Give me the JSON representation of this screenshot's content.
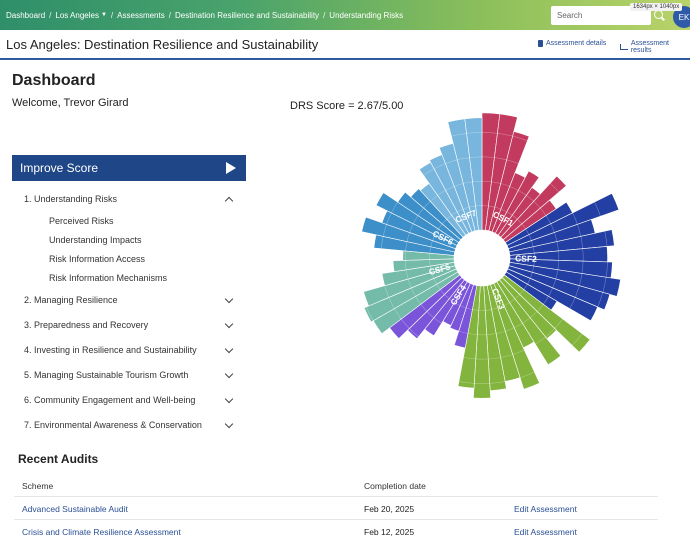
{
  "breadcrumb": [
    "Dashboard",
    "Los Angeles",
    "Assessments",
    "Destination Resilience and Sustainability",
    "Understanding Risks"
  ],
  "search": {
    "placeholder": "Search"
  },
  "size_tip": "1634px × 1040px",
  "avatar_initials": "EK",
  "header": {
    "title": "Los Angeles: Destination Resilience and Sustainability",
    "assessment_details": "Assessment details",
    "assessment_results": "Assessment results"
  },
  "dashboard": {
    "title": "Dashboard",
    "welcome": "Welcome, Trevor Girard"
  },
  "improve": {
    "label": "Improve Score"
  },
  "menu": [
    {
      "label": "1. Understanding Risks",
      "expanded": true,
      "subitems": [
        "Perceived Risks",
        "Understanding Impacts",
        "Risk Information Access",
        "Risk Information Mechanisms"
      ]
    },
    {
      "label": "2. Managing Resilience"
    },
    {
      "label": "3. Preparedness and Recovery"
    },
    {
      "label": "4. Investing in Resilience and Sustainability"
    },
    {
      "label": "5. Managing Sustainable Tourism Growth"
    },
    {
      "label": "6. Community Engagement and Well-being"
    },
    {
      "label": "7. Environmental Awareness & Conservation"
    }
  ],
  "score": {
    "label": "DRS Score = 2.67/5.00"
  },
  "chart_data": {
    "type": "radial-bar",
    "title": "DRS Score = 2.67/5.00",
    "max": 5,
    "sectors": [
      {
        "name": "CSF1",
        "color": "#c23b5e",
        "values": [
          4.8,
          4.8,
          4.2,
          2.6,
          2.9,
          2.4,
          3.4,
          2.5
        ]
      },
      {
        "name": "CSF2",
        "color": "#243fa3",
        "values": [
          3.0,
          4.8,
          3.6,
          4.3,
          4.0,
          4.2,
          4.6,
          4.3,
          4.0,
          2.4
        ]
      },
      {
        "name": "CSF3",
        "color": "#83b43d",
        "values": [
          4.4,
          3.1,
          4.0,
          2.9,
          4.5,
          4.0,
          4.3,
          4.6,
          4.2
        ]
      },
      {
        "name": "CSF4",
        "color": "#7b55d9",
        "values": [
          2.6,
          2.0,
          1.9,
          2.6,
          3.1,
          3.6
        ]
      },
      {
        "name": "CSF5",
        "color": "#74bba9",
        "values": [
          4.0,
          4.1,
          3.9,
          3.0,
          2.5,
          2.1
        ]
      },
      {
        "name": "CSF6",
        "color": "#3d8fc9",
        "values": [
          3.3,
          3.9,
          3.2,
          3.7,
          3.0,
          2.7
        ]
      },
      {
        "name": "CSF7",
        "color": "#78b6de",
        "values": [
          2.6,
          3.3,
          3.4,
          3.7,
          4.6,
          4.6
        ]
      }
    ]
  },
  "audits": {
    "title": "Recent Audits",
    "columns": [
      "Scheme",
      "Completion date",
      ""
    ],
    "rows": [
      {
        "scheme": "Advanced Sustainable Audit",
        "date": "Feb 20, 2025",
        "action": "Edit Assessment"
      },
      {
        "scheme": "Crisis and Climate Resilience Assessment",
        "date": "Feb 12, 2025",
        "action": "Edit Assessment"
      }
    ]
  }
}
